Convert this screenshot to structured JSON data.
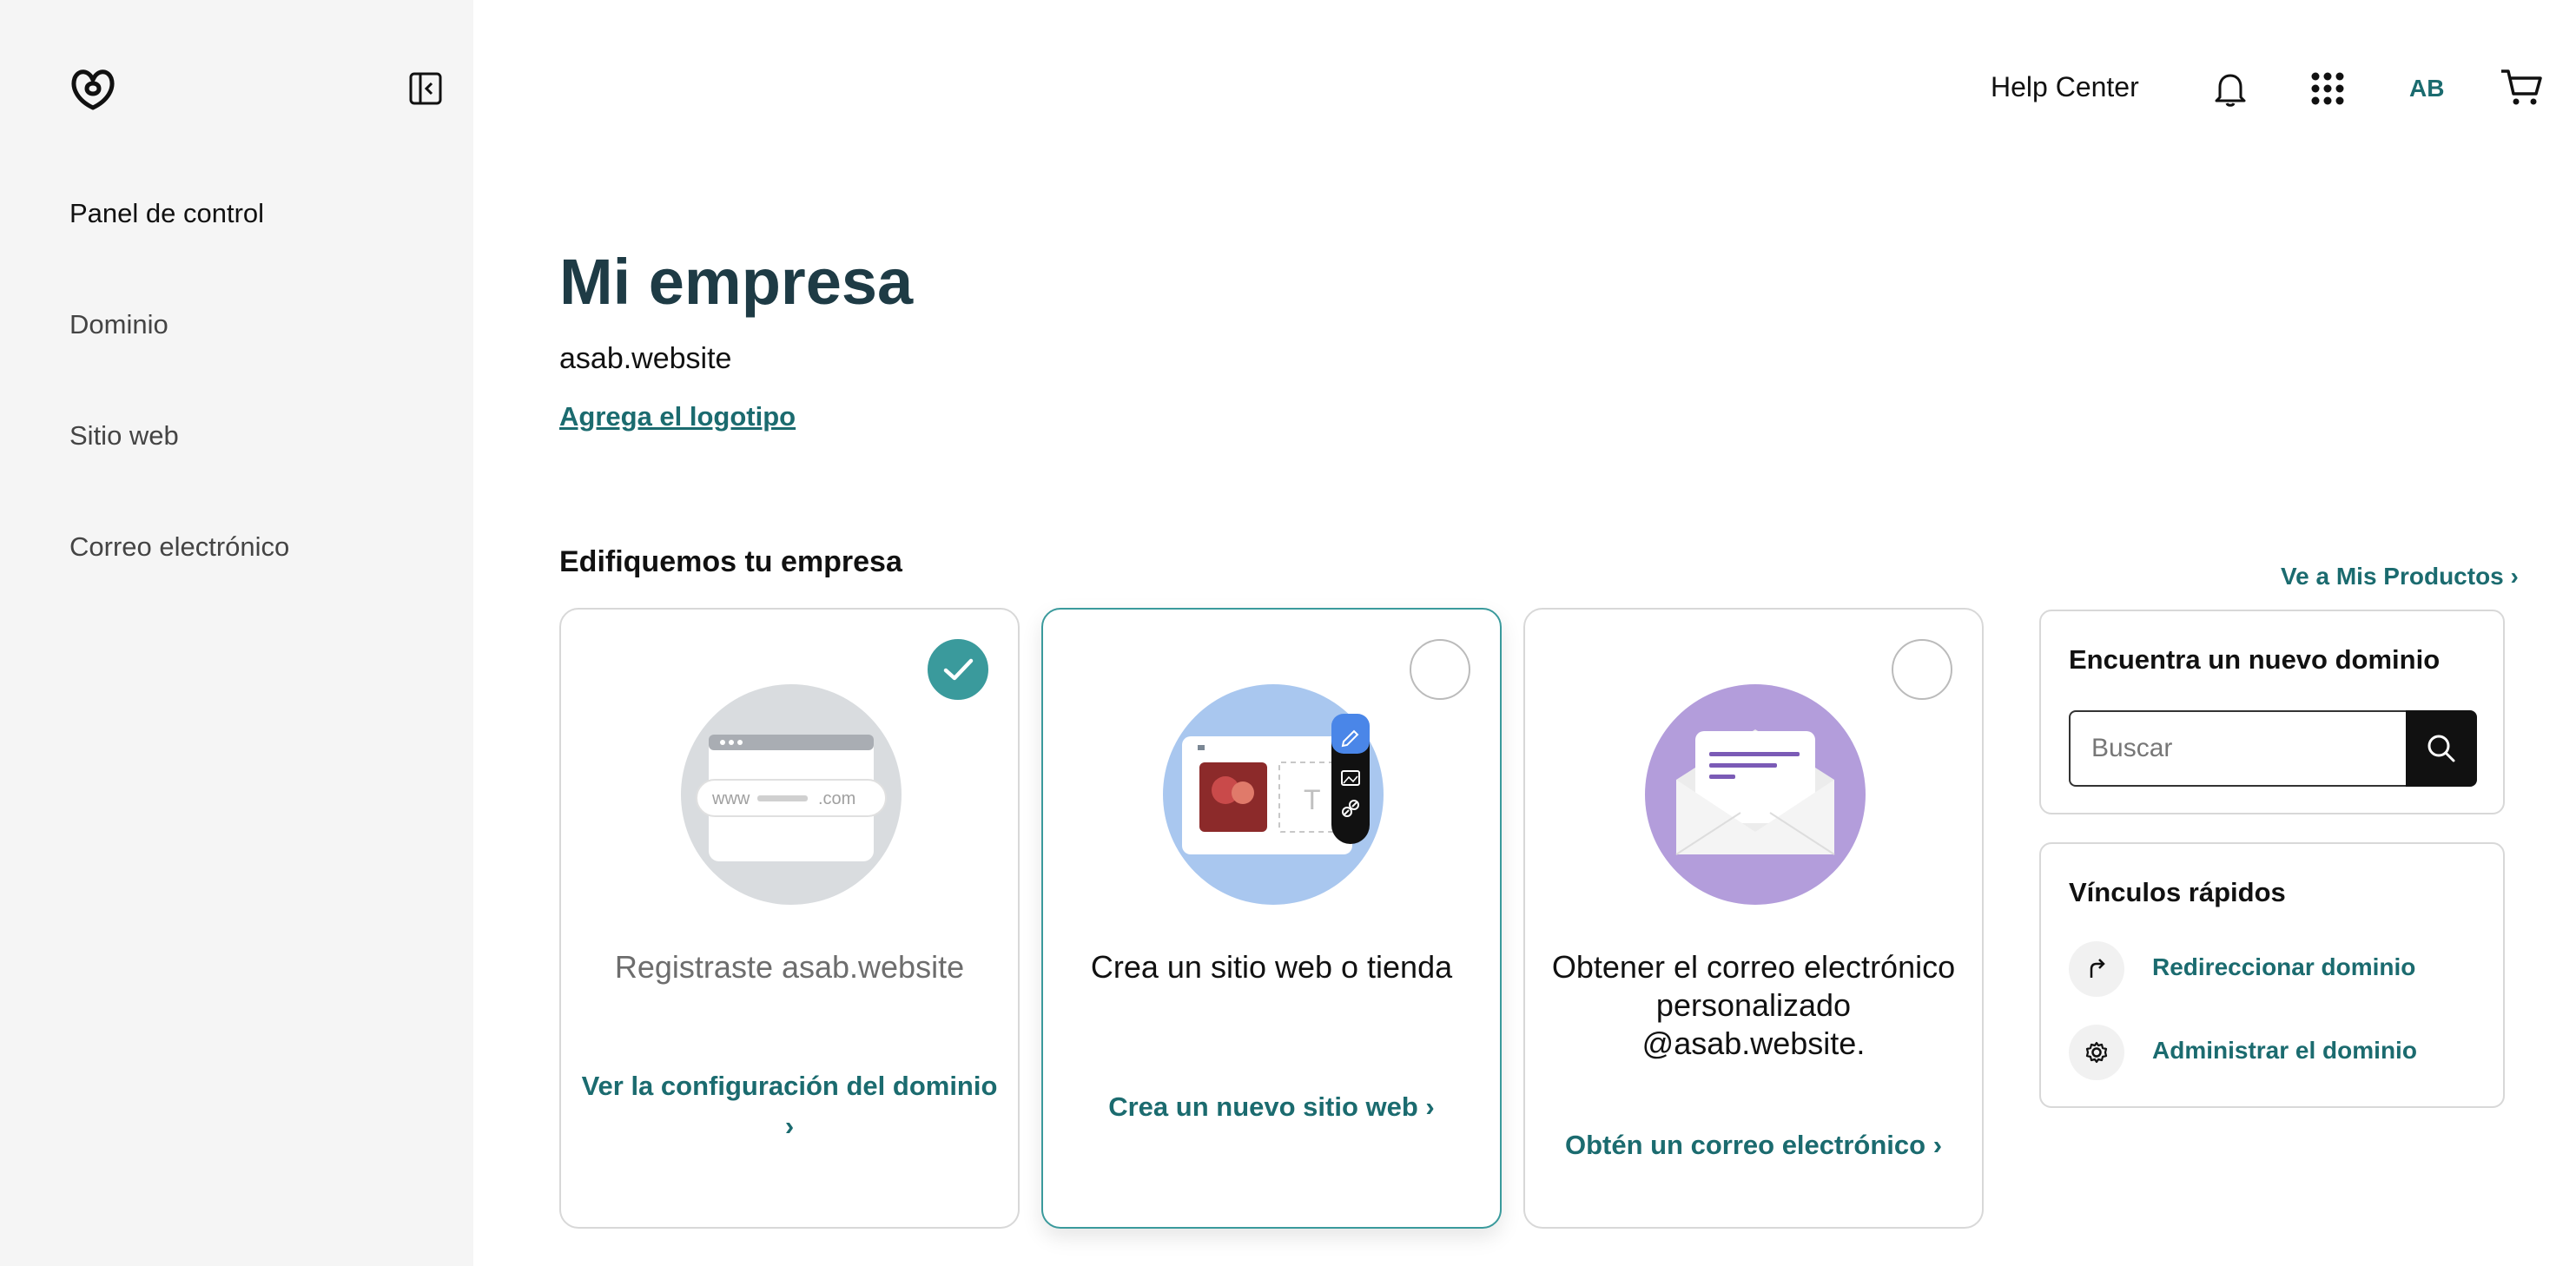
{
  "sidebar": {
    "items": [
      {
        "label": "Panel de control"
      },
      {
        "label": "Dominio"
      },
      {
        "label": "Sitio web"
      },
      {
        "label": "Correo electrónico"
      }
    ]
  },
  "header": {
    "help": "Help Center",
    "avatar": "AB",
    "icons": [
      "bell-icon",
      "apps-grid-icon",
      "cart-icon"
    ]
  },
  "main": {
    "title": "Mi empresa",
    "domain": "asab.website",
    "add_logo": "Agrega el logotipo",
    "section_title": "Edifiquemos tu empresa",
    "products_link": "Ve a Mis Productos ›",
    "cards": [
      {
        "text": "Registraste asab.website",
        "link": "Ver la configuración del dominio",
        "link_arrow": "›",
        "completed": true
      },
      {
        "text": "Crea un sitio web o tienda",
        "link": "Crea un nuevo sitio web",
        "link_arrow": "›",
        "completed": false
      },
      {
        "text": "Obtener el correo electrónico personalizado @asab.website.",
        "link": "Obtén un correo electrónico",
        "link_arrow": "›",
        "completed": false
      }
    ],
    "illustration": {
      "www": "www",
      "com": ".com"
    }
  },
  "domain_search": {
    "title": "Encuentra un nuevo dominio",
    "placeholder": "Buscar"
  },
  "quick_links": {
    "title": "Vínculos rápidos",
    "items": [
      {
        "label": "Redireccionar dominio",
        "icon": "redirect-arrow-icon"
      },
      {
        "label": "Administrar el dominio",
        "icon": "gear-icon"
      }
    ]
  },
  "colors": {
    "accent": "#1b6b6f",
    "check": "#3a9a9c",
    "title": "#1e3b45",
    "sidebar_bg": "#f5f5f5",
    "domain_circle": "#d9dcdf",
    "website_circle": "#a9c7ef",
    "email_circle": "#b39ddb"
  }
}
